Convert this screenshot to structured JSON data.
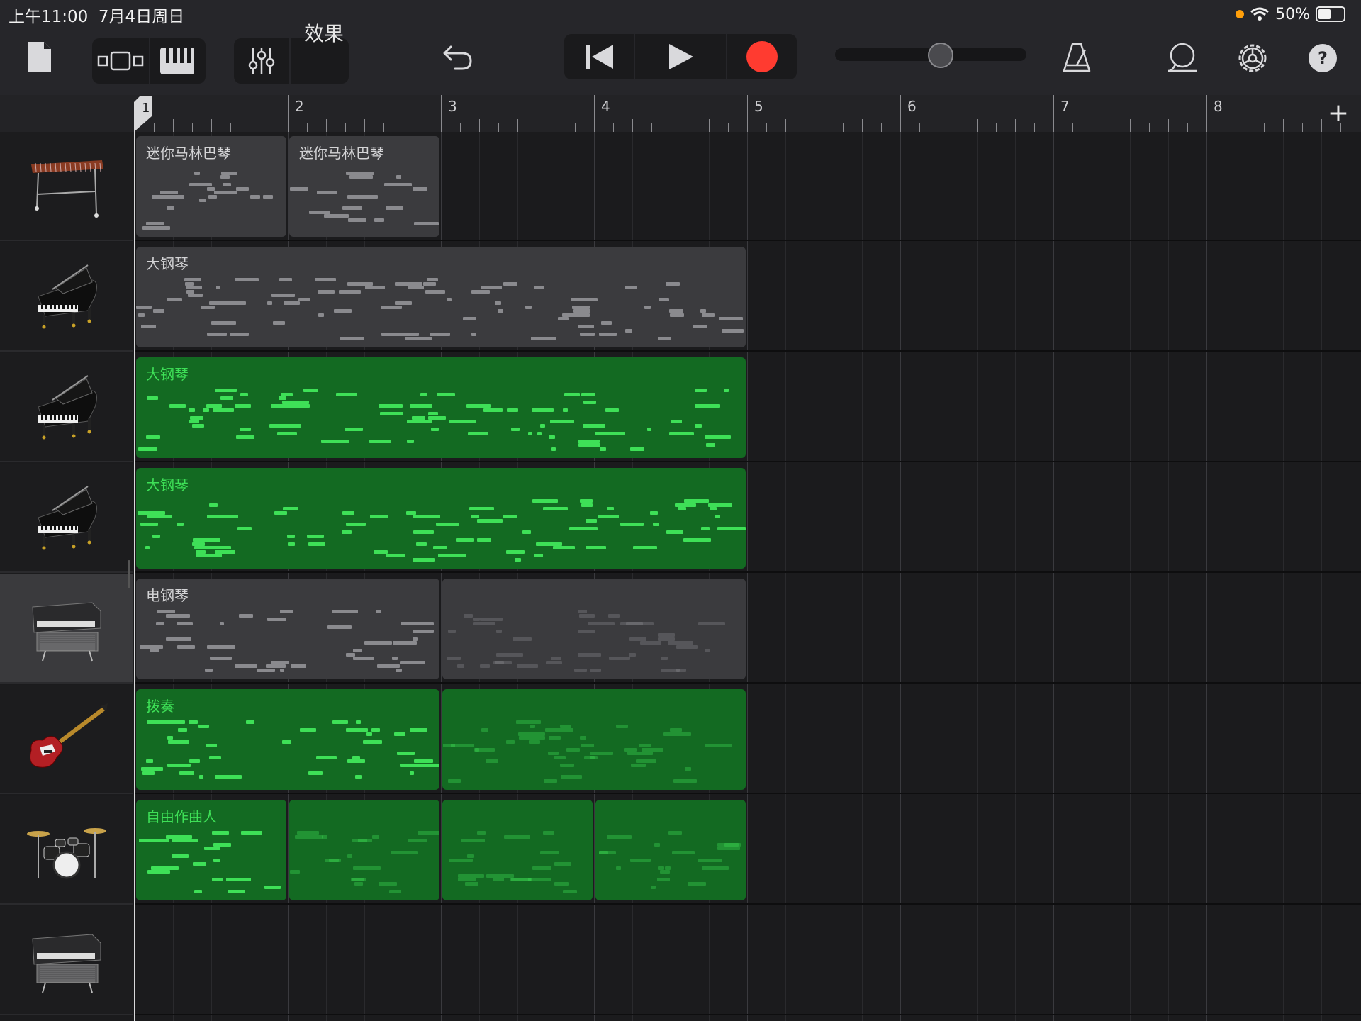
{
  "status": {
    "time": "上午11:00",
    "date": "7月4日周日",
    "battery": "50%",
    "battery_level": 0.5
  },
  "toolbar": {
    "fx_label": "效果",
    "icons": [
      "document-icon",
      "tracks-view-icon",
      "keyboard-icon",
      "mixer-icon",
      "undo-icon",
      "rewind-icon",
      "play-icon",
      "record-icon",
      "metronome-icon",
      "loop-icon",
      "settings-icon",
      "help-icon"
    ],
    "volume_level": 0.55,
    "record_color": "#ff3b30"
  },
  "ruler": {
    "bars": [
      "1",
      "2",
      "3",
      "4",
      "5",
      "6",
      "7",
      "8"
    ],
    "add_label": "+"
  },
  "tracks": [
    {
      "instrument": "mini-marimba-icon",
      "selected": false,
      "regions": [
        {
          "label": "迷你马林巴琴",
          "color": "gray"
        },
        {
          "label": "迷你马林巴琴",
          "color": "gray"
        }
      ]
    },
    {
      "instrument": "grand-piano-icon",
      "selected": false,
      "regions": [
        {
          "label": "大钢琴",
          "color": "gray"
        }
      ]
    },
    {
      "instrument": "grand-piano-icon",
      "selected": false,
      "regions": [
        {
          "label": "大钢琴",
          "color": "green"
        }
      ]
    },
    {
      "instrument": "grand-piano-icon",
      "selected": false,
      "regions": [
        {
          "label": "大钢琴",
          "color": "green"
        }
      ]
    },
    {
      "instrument": "electric-piano-icon",
      "selected": true,
      "regions": [
        {
          "label": "电钢琴",
          "color": "gray"
        },
        {
          "label": "",
          "color": "gray"
        }
      ]
    },
    {
      "instrument": "bass-guitar-icon",
      "selected": false,
      "regions": [
        {
          "label": "拨奏",
          "color": "green"
        },
        {
          "label": "",
          "color": "green"
        }
      ]
    },
    {
      "instrument": "drum-kit-icon",
      "selected": false,
      "regions": [
        {
          "label": "自由作曲人",
          "color": "green"
        },
        {
          "label": "",
          "color": "green"
        },
        {
          "label": "",
          "color": "green"
        },
        {
          "label": "",
          "color": "green"
        }
      ]
    },
    {
      "instrument": "electric-piano-icon",
      "selected": false,
      "regions": []
    }
  ],
  "colors": {
    "green_region": "#136a22",
    "green_note": "#3ee057",
    "gray_region": "#3b3b3e",
    "accent_red": "#ff3b30"
  }
}
